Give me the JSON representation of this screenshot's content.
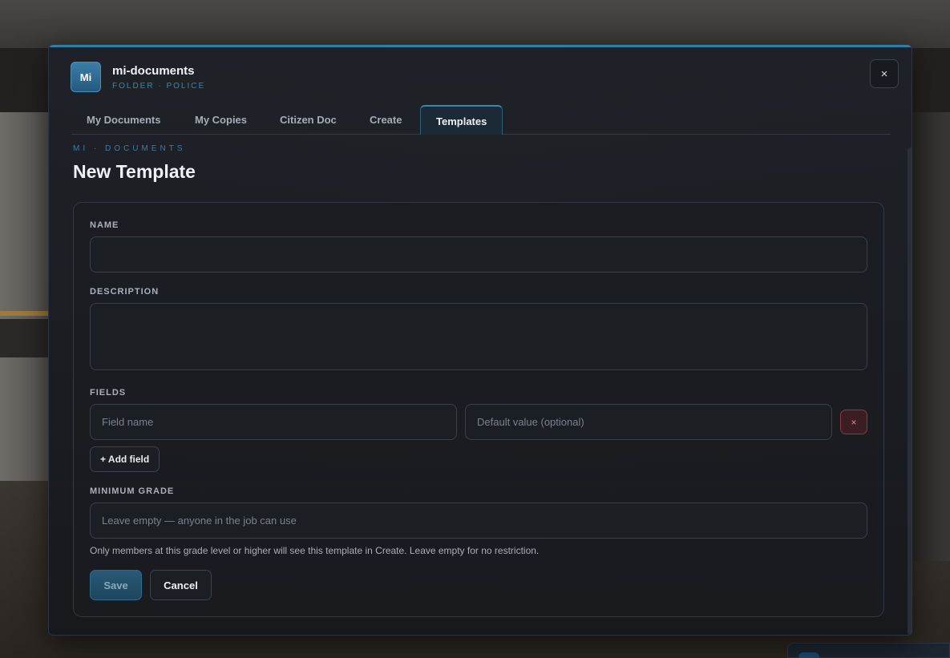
{
  "app": {
    "badge": "Mi",
    "title": "mi-documents",
    "subtitle": "FOLDER · POLICE",
    "close_label": "×"
  },
  "tabs": [
    {
      "label": "My Documents",
      "active": false
    },
    {
      "label": "My Copies",
      "active": false
    },
    {
      "label": "Citizen Doc",
      "active": false
    },
    {
      "label": "Create",
      "active": false
    },
    {
      "label": "Templates",
      "active": true
    }
  ],
  "breadcrumb": "MI · DOCUMENTS",
  "page_title": "New Template",
  "form": {
    "name_label": "NAME",
    "name_value": "",
    "description_label": "DESCRIPTION",
    "description_value": "",
    "fields_label": "FIELDS",
    "field_name_placeholder": "Field name",
    "default_value_placeholder": "Default value (optional)",
    "remove_label": "×",
    "add_field_label": "+ Add field",
    "min_grade_label": "MINIMUM GRADE",
    "min_grade_placeholder": "Leave empty — anyone in the job can use",
    "min_grade_hint": "Only members at this grade level or higher will see this template in Create. Leave empty for no restriction.",
    "save_label": "Save",
    "cancel_label": "Cancel"
  },
  "colors": {
    "accent": "#2e7ea8",
    "danger": "#8a3a44"
  }
}
